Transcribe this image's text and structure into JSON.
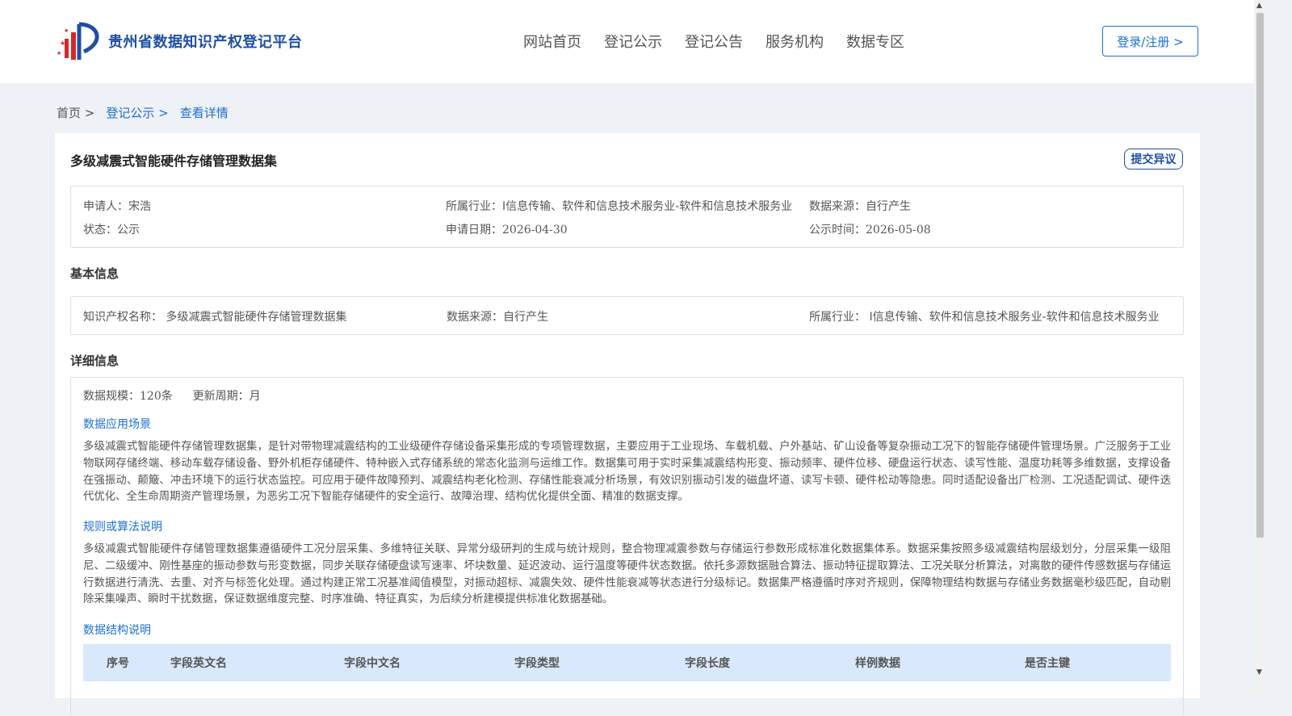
{
  "header": {
    "logo_text": "贵州省数据知识产权登记平台",
    "nav": [
      "网站首页",
      "登记公示",
      "登记公告",
      "服务机构",
      "数据专区"
    ],
    "login_label": "登录/注册 >"
  },
  "breadcrumb": {
    "home": "首页 >",
    "publicity": "登记公示 >",
    "current": "查看详情"
  },
  "dataset": {
    "title": "多级减震式智能硬件存储管理数据集",
    "objection_label": "提交异议"
  },
  "summary": {
    "applicant_label": "申请人：",
    "applicant": "宋浩",
    "industry_label": "所属行业：",
    "industry": "I信息传输、软件和信息技术服务业-软件和信息技术服务业",
    "source_label": "数据来源：",
    "source": "自行产生",
    "status_label": "状态：",
    "status": "公示",
    "apply_date_label": "申请日期：",
    "apply_date": "2026-04-30",
    "publicity_time_label": "公示时间：",
    "publicity_time": "2026-05-08"
  },
  "basic": {
    "section_title": "基本信息",
    "ip_name_label": "知识产权名称：",
    "ip_name": "多级减震式智能硬件存储管理数据集",
    "source_label": "数据来源：",
    "source": "自行产生",
    "industry_label": "所属行业：",
    "industry": "I信息传输、软件和信息技术服务业-软件和信息技术服务业"
  },
  "detail": {
    "section_title": "详细信息",
    "scale_label": "数据规模：",
    "scale": "120条",
    "cycle_label": "更新周期：",
    "cycle": "月",
    "scenario_title": "数据应用场景",
    "scenario_text": "多级减震式智能硬件存储管理数据集，是针对带物理减震结构的工业级硬件存储设备采集形成的专项管理数据，主要应用于工业现场、车载机载、户外基站、矿山设备等复杂振动工况下的智能存储硬件管理场景。广泛服务于工业物联网存储终端、移动车载存储设备、野外机柜存储硬件、特种嵌入式存储系统的常态化监测与运维工作。数据集可用于实时采集减震结构形变、振动频率、硬件位移、硬盘运行状态、读写性能、温度功耗等多维数据，支撑设备在强振动、颠簸、冲击环境下的运行状态监控。可应用于硬件故障预判、减震结构老化检测、存储性能衰减分析场景，有效识别振动引发的磁盘坏道、读写卡顿、硬件松动等隐患。同时适配设备出厂检测、工况适配调试、硬件迭代优化、全生命周期资产管理场景，为恶劣工况下智能存储硬件的安全运行、故障治理、结构优化提供全面、精准的数据支撑。",
    "rule_title": "规则或算法说明",
    "rule_text": "多级减震式智能硬件存储管理数据集遵循硬件工况分层采集、多维特征关联、异常分级研判的生成与统计规则，整合物理减震参数与存储运行参数形成标准化数据集体系。数据采集按照多级减震结构层级划分，分层采集一级阻尼、二级缓冲、刚性基座的振动参数与形变数据，同步关联存储硬盘读写速率、坏块数量、延迟波动、运行温度等硬件状态数据。依托多源数据融合算法、振动特征提取算法、工况关联分析算法，对离散的硬件传感数据与存储运行数据进行清洗、去重、对齐与标签化处理。通过构建正常工况基准阈值模型，对振动超标、减震失效、硬件性能衰减等状态进行分级标记。数据集严格遵循时序对齐规则，保障物理结构数据与存储业务数据毫秒级匹配，自动剔除采集噪声、瞬时干扰数据，保证数据维度完整、时序准确、特征真实，为后续分析建模提供标准化数据基础。",
    "structure_title": "数据结构说明",
    "table_headers": [
      "序号",
      "字段英文名",
      "字段中文名",
      "字段类型",
      "字段长度",
      "样例数据",
      "是否主键"
    ]
  },
  "colors": {
    "brand": "#1e4fa3",
    "link": "#1e6fd0",
    "table_header_bg": "#d9e8fb",
    "page_bg": "#eef1f5"
  }
}
